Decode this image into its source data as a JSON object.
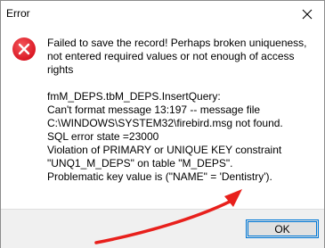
{
  "window": {
    "title": "Error"
  },
  "icons": {
    "close": "close-icon",
    "error": "error-icon"
  },
  "message": {
    "summary_lines": [
      "Failed to save the record! Perhaps broken uniqueness,",
      "not entered required values or not enough of access",
      "rights"
    ],
    "detail_lines": [
      "fmM_DEPS.tbM_DEPS.InsertQuery:",
      "Can't format message 13:197 -- message file",
      "C:\\WINDOWS\\SYSTEM32\\firebird.msg not found.",
      "SQL error state =23000",
      "Violation of PRIMARY or UNIQUE KEY constraint",
      "\"UNQ1_M_DEPS\" on table \"M_DEPS\".",
      "Problematic key value is (\"NAME\" = 'Dentistry')."
    ]
  },
  "buttons": {
    "ok_label": "OK"
  },
  "colors": {
    "error_red": "#e81123",
    "annotation_arrow": "#e8201c",
    "button_border": "#0078d7",
    "footer_bg": "#f0f0f0"
  }
}
